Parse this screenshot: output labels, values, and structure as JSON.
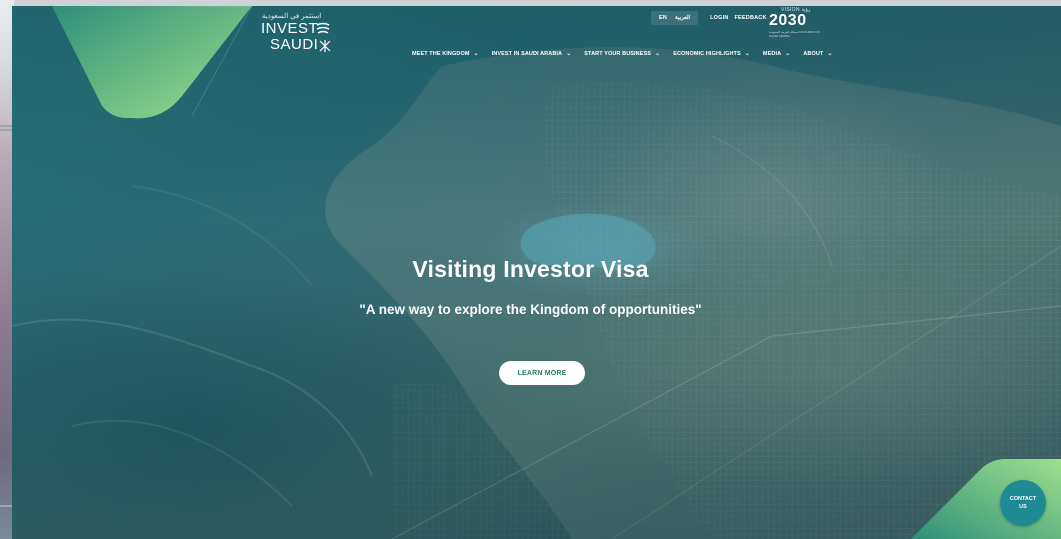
{
  "logo": {
    "arabic": "استثمر في السعودية",
    "invest": "INVEST",
    "saudi": "SAUDI"
  },
  "utils": {
    "lang_en": "EN",
    "lang_ar": "العربية",
    "login": "LOGIN",
    "feedback": "FEEDBACK"
  },
  "vision": {
    "label": "VISION رؤية",
    "year": "2030",
    "sub": "المملكة العربية السعودية KINGDOM OF SAUDI ARABIA"
  },
  "nav": [
    {
      "label": "MEET THE KINGDOM"
    },
    {
      "label": "INVEST IN SAUDI ARABIA"
    },
    {
      "label": "START YOUR BUSINESS"
    },
    {
      "label": "ECONOMIC HIGHLIGHTS"
    },
    {
      "label": "MEDIA"
    },
    {
      "label": "ABOUT"
    }
  ],
  "hero": {
    "title": "Visiting Investor Visa",
    "subtitle": "\"A new way to explore the Kingdom of opportunities\"",
    "cta": "LEARN MORE"
  },
  "contact": {
    "line1": "CONTACT",
    "line2": "US"
  },
  "icons": {
    "nav_chevron": "chevron-down-icon",
    "logo_mark": "palm-swords-icon"
  },
  "colors": {
    "brand_green": "#8fd88a",
    "brand_teal": "#1d8a94",
    "cta_text": "#2a7a5e"
  }
}
